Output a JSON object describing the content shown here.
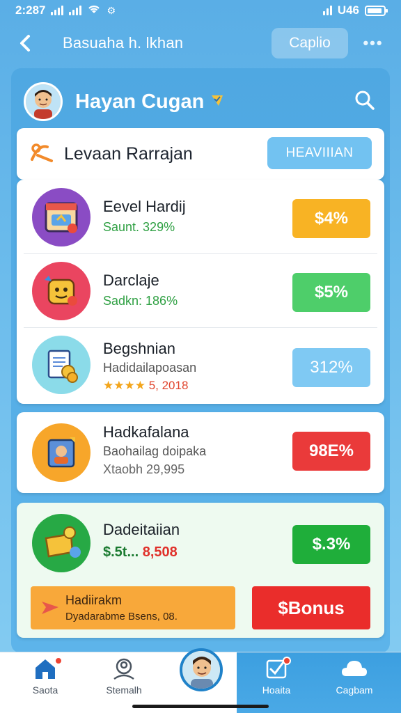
{
  "status_bar": {
    "time": "2:287",
    "battery_text": "U46"
  },
  "nav": {
    "title": "Basuaha h. lkhan",
    "button_label": "Caplio",
    "more_label": "•••"
  },
  "profile": {
    "name": "Hayan Cugan"
  },
  "header_card": {
    "title": "Levaan Rarrajan",
    "button_label": "HEAVIIIAN"
  },
  "items": [
    {
      "title": "Eevel Hardij",
      "subtitle": "Saunt. 329%",
      "value": "$4%",
      "value_color": "#f8b324",
      "circle_color": "#8a4cc4"
    },
    {
      "title": "Darclaje",
      "subtitle": "Sadkn: 186%",
      "value": "$5%",
      "value_color": "#4ece6a",
      "circle_color": "#ea4560"
    },
    {
      "title": "Begshnian",
      "subtitle": "Hadidailapoasan",
      "stars": "★★★★",
      "rating": "5, 2018",
      "value": "312%",
      "value_color": "#7fc9f3",
      "circle_color": "#7fd6e6"
    }
  ],
  "single_item": {
    "title": "Hadkafalana",
    "subtitle": "Baohailag doipaka",
    "note": "Xtaobh 29,995",
    "value": "98E%",
    "value_color": "#ea3a3a",
    "circle_color": "#f7a62a"
  },
  "green_item": {
    "title": "Dadeitaiian",
    "amount": "$.5t...",
    "amount_value": "8,508",
    "value": "$.3%",
    "value_color": "#1fae3a",
    "circle_color": "#27a945"
  },
  "bonus": {
    "line1": "Hadiirakm",
    "line2": "Dyadarabme Bsens, 08.",
    "button_label": "$Bonus"
  },
  "bottom_nav": [
    {
      "label": "Saota",
      "icon": "home-icon"
    },
    {
      "label": "Stemalh",
      "icon": "profile-search-icon"
    },
    {
      "label": "",
      "icon": "avatar"
    },
    {
      "label": "Hoaita",
      "icon": "checkbox-icon"
    },
    {
      "label": "Cagbam",
      "icon": "cloud-icon"
    }
  ]
}
